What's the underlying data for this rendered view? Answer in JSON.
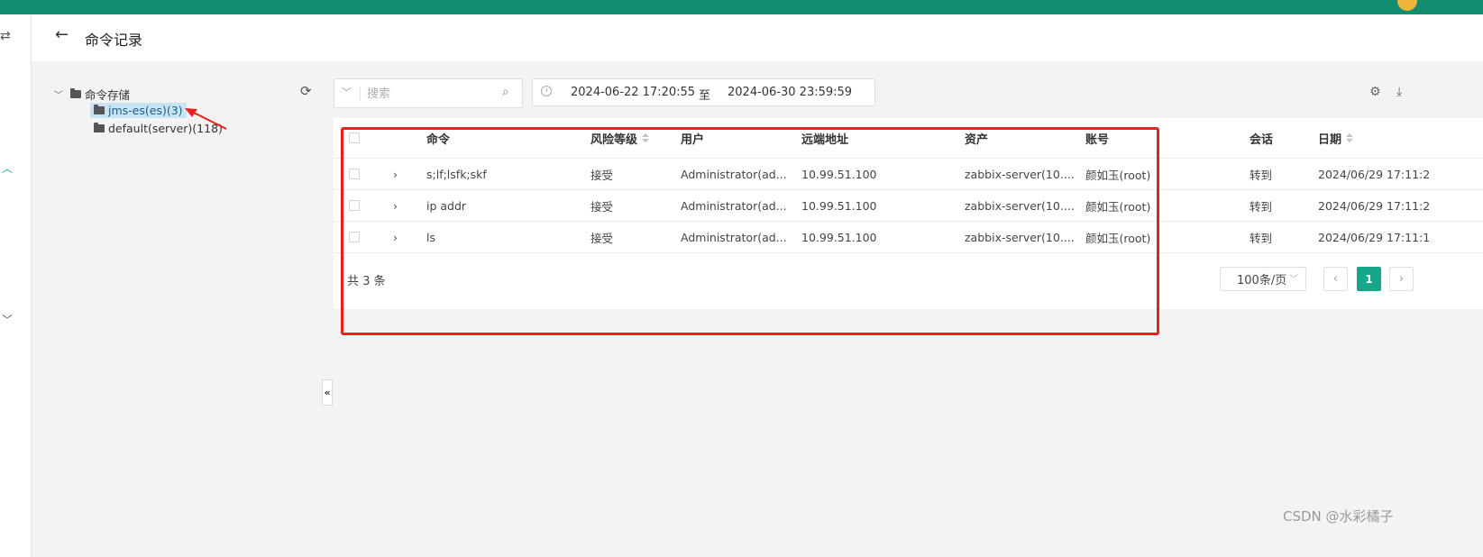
{
  "header": {
    "title": "命令记录",
    "back_icon": "arrow-left-icon"
  },
  "tree": {
    "root_label": "命令存储",
    "nodes": [
      {
        "label": "jms-es(es)(3)",
        "selected": true
      },
      {
        "label": "default(server)(118)",
        "selected": false
      }
    ]
  },
  "toolbar": {
    "search_placeholder": "搜索",
    "date_start": "2024-06-22 17:20:55",
    "date_separator": "至",
    "date_end": "2024-06-30 23:59:59"
  },
  "table": {
    "columns": [
      "命令",
      "风险等级",
      "用户",
      "远端地址",
      "资产",
      "账号",
      "会话",
      "日期"
    ],
    "rows": [
      {
        "command": "s;lf;lsfk;skf",
        "risk": "接受",
        "user": "Administrator(ad...",
        "remote": "10.99.51.100",
        "asset": "zabbix-server(10....",
        "account": "颜如玉(root)",
        "session": "转到",
        "date": "2024/06/29 17:11:2"
      },
      {
        "command": "ip addr",
        "risk": "接受",
        "user": "Administrator(ad...",
        "remote": "10.99.51.100",
        "asset": "zabbix-server(10....",
        "account": "颜如玉(root)",
        "session": "转到",
        "date": "2024/06/29 17:11:2"
      },
      {
        "command": "ls",
        "risk": "接受",
        "user": "Administrator(ad...",
        "remote": "10.99.51.100",
        "asset": "zabbix-server(10....",
        "account": "颜如玉(root)",
        "session": "转到",
        "date": "2024/06/29 17:11:1"
      }
    ]
  },
  "pagination": {
    "total_text": "共 3 条",
    "page_size": "100条/页",
    "current_page": "1"
  },
  "watermark": "CSDN @水彩橘子",
  "colors": {
    "brand": "#128c6f",
    "accent": "#17a689",
    "highlight_box": "#e8211f",
    "link": "#1a73c5"
  }
}
